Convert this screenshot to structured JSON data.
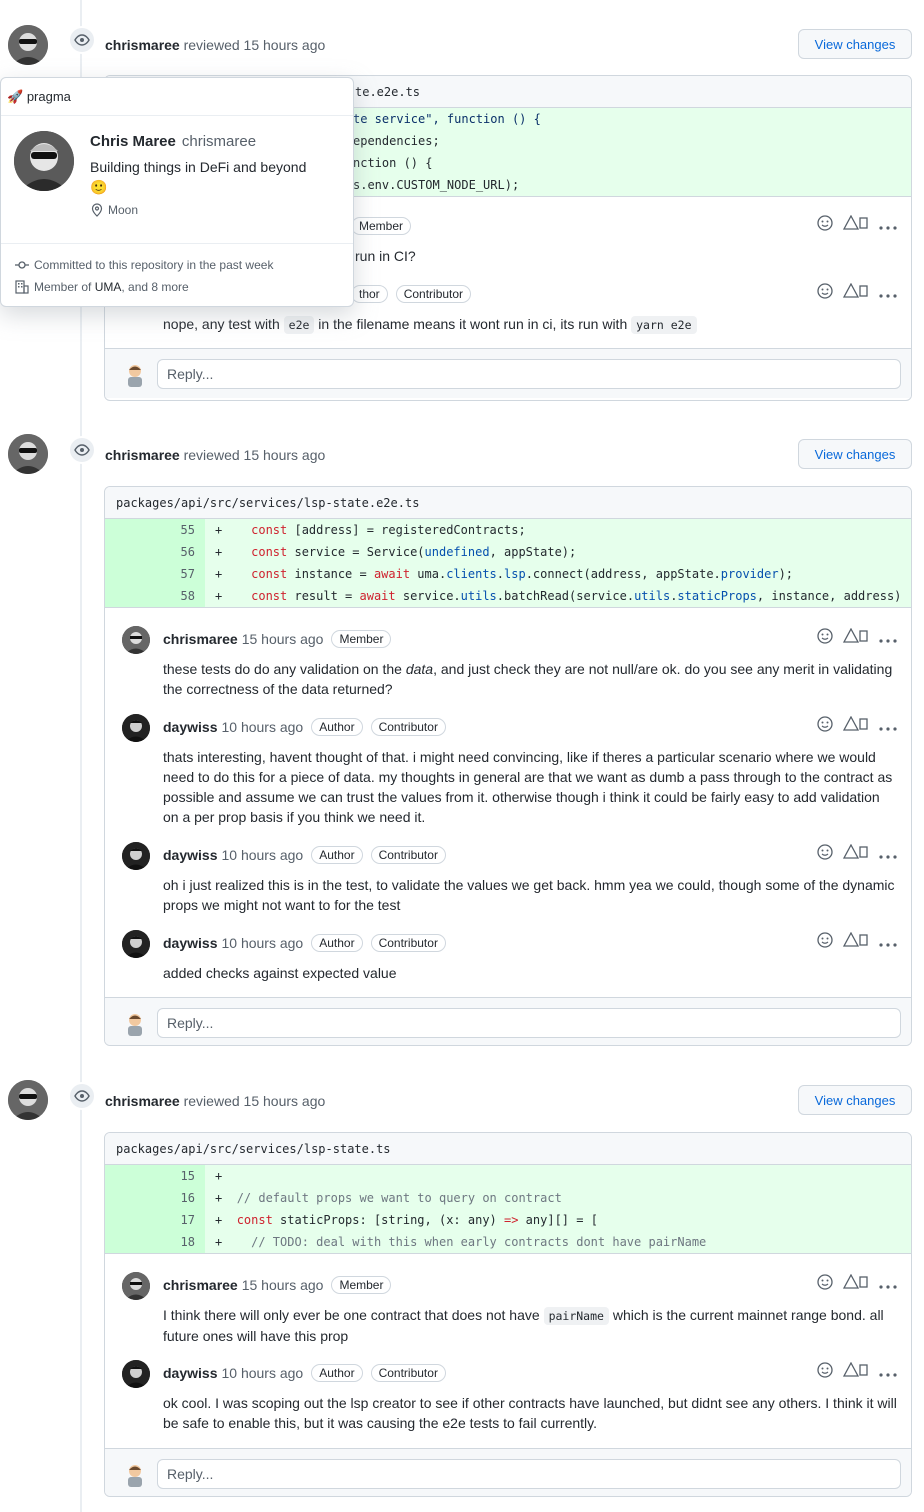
{
  "reviews": [
    {
      "reviewer": "chrismaree",
      "action": "reviewed",
      "time": "15 hours ago",
      "view_changes": "View changes",
      "file_path": "packages/api/src/services/lsp-state.e2e.ts",
      "file_visible": "te.e2e.ts",
      "code_visible": [
        "te service\", function () {",
        "ependencies;",
        "nction () {",
        "s.env.CUSTOM_NODE_URL);"
      ],
      "comments": [
        {
          "badges": [
            "Member"
          ],
          "body": "run in CI?"
        },
        {
          "badges": [
            "thor",
            "Contributor"
          ],
          "body_parts": [
            "nope, any test with ",
            "e2e",
            " in the filename means it wont run in ci, its run with ",
            "yarn e2e"
          ]
        }
      ],
      "reply_placeholder": "Reply..."
    },
    {
      "reviewer": "chrismaree",
      "action": "reviewed",
      "time": "15 hours ago",
      "view_changes": "View changes",
      "file_path": "packages/api/src/services/lsp-state.e2e.ts",
      "line_numbers": [
        "55",
        "56",
        "57",
        "58"
      ],
      "comments": [
        {
          "author": "chrismaree",
          "time": "15 hours ago",
          "badges": [
            "Member"
          ],
          "body_parts": [
            "these tests do do any validation on the ",
            "data",
            ", and just check they are not null/are ok. do you see any merit in validating the correctness of the data returned?"
          ]
        },
        {
          "author": "daywiss",
          "time": "10 hours ago",
          "badges": [
            "Author",
            "Contributor"
          ],
          "body": "thats interesting, havent thought of that. i might need convincing, like if theres a particular scenario where we would need to do this for a piece of data. my thoughts in general are that we want as dumb a pass through to the contract as possible and assume we can trust the values from it. otherwise though i think it could be fairly easy to add validation on a per prop basis if you think we need it."
        },
        {
          "author": "daywiss",
          "time": "10 hours ago",
          "badges": [
            "Author",
            "Contributor"
          ],
          "body": "oh i just realized this is in the test, to validate the values we get back. hmm yea we could, though some of the dynamic props we might not want to for the test"
        },
        {
          "author": "daywiss",
          "time": "10 hours ago",
          "badges": [
            "Author",
            "Contributor"
          ],
          "body": "added checks against expected value"
        }
      ],
      "reply_placeholder": "Reply..."
    },
    {
      "reviewer": "chrismaree",
      "action": "reviewed",
      "time": "15 hours ago",
      "view_changes": "View changes",
      "file_path": "packages/api/src/services/lsp-state.ts",
      "line_numbers": [
        "15",
        "16",
        "17",
        "18"
      ],
      "comments": [
        {
          "author": "chrismaree",
          "time": "15 hours ago",
          "badges": [
            "Member"
          ],
          "body_parts": [
            "I think there will only ever be one contract that does not have ",
            "pairName",
            " which is the current mainnet range bond. all future ones will have this prop"
          ]
        },
        {
          "author": "daywiss",
          "time": "10 hours ago",
          "badges": [
            "Author",
            "Contributor"
          ],
          "body": "ok cool. I was scoping out the lsp creator to see if other contracts have launched, but didnt see any others. I think it will be safe to enable this, but it was causing the e2e tests to fail currently."
        }
      ],
      "reply_placeholder": "Reply..."
    }
  ],
  "popover": {
    "org": "pragma",
    "name": "Chris Maree",
    "login": "chrismaree",
    "bio": "Building things in DeFi and beyond",
    "location": "Moon",
    "committed": "Committed to this repository in the past week",
    "member_prefix": "Member of ",
    "member_org": "UMA",
    "member_suffix": ", and 8 more"
  },
  "colors": {
    "accent": "#0969da",
    "diff_add": "#e6ffec",
    "diff_num": "#ccffd8",
    "border": "#d0d7de"
  }
}
